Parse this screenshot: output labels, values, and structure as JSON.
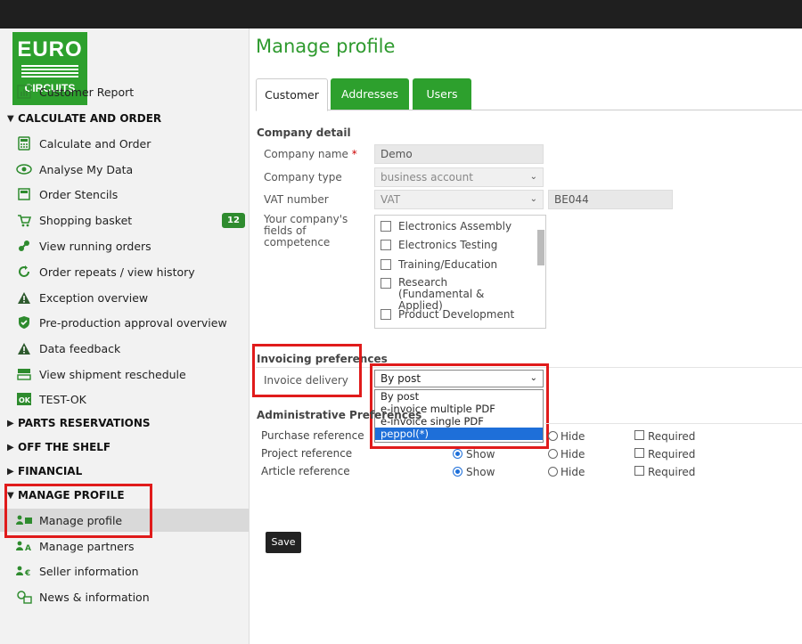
{
  "logo": {
    "line1": "EURO",
    "line2": "CIRCUITS"
  },
  "sidebar": {
    "items": [
      {
        "label": "Customer Report",
        "icon": "report-icon"
      },
      {
        "label": "CALCULATE AND ORDER",
        "section": true,
        "expanded": true
      },
      {
        "label": "Calculate and Order",
        "icon": "calculator-icon"
      },
      {
        "label": "Analyse My Data",
        "icon": "eye-icon"
      },
      {
        "label": "Order Stencils",
        "icon": "stencil-icon"
      },
      {
        "label": "Shopping basket",
        "icon": "cart-icon",
        "badge": "12"
      },
      {
        "label": "View running orders",
        "icon": "running-orders-icon"
      },
      {
        "label": "Order repeats / view history",
        "icon": "repeat-icon"
      },
      {
        "label": "Exception overview",
        "icon": "warning-icon"
      },
      {
        "label": "Pre-production approval overview",
        "icon": "shield-check-icon"
      },
      {
        "label": "Data feedback",
        "icon": "warning-icon"
      },
      {
        "label": "View shipment reschedule",
        "icon": "shipment-icon"
      },
      {
        "label": "TEST-OK",
        "icon": "ok-icon"
      },
      {
        "label": "PARTS RESERVATIONS",
        "section": true,
        "expanded": false
      },
      {
        "label": "OFF THE SHELF",
        "section": true,
        "expanded": false
      },
      {
        "label": "FINANCIAL",
        "section": true,
        "expanded": false
      },
      {
        "label": "MANAGE PROFILE",
        "section": true,
        "expanded": true
      },
      {
        "label": "Manage profile",
        "icon": "profile-card-icon",
        "active": true
      },
      {
        "label": "Manage partners",
        "icon": "partners-icon"
      },
      {
        "label": "Seller information",
        "icon": "seller-icon"
      },
      {
        "label": "News & information",
        "icon": "news-icon"
      }
    ]
  },
  "main": {
    "title": "Manage profile",
    "tabs": [
      {
        "label": "Customer",
        "active": true
      },
      {
        "label": "Addresses"
      },
      {
        "label": "Users"
      }
    ],
    "company_detail": {
      "heading": "Company detail",
      "company_name_label": "Company name",
      "company_name_required": "*",
      "company_name_value": "Demo",
      "company_type_label": "Company type",
      "company_type_value": "business account",
      "vat_label": "VAT number",
      "vat_select_value": "VAT",
      "vat_value": "BE044",
      "fields_label": "Your company's fields of competence",
      "fields_options": [
        "Electronics Assembly",
        "Electronics Testing",
        "Training/Education",
        "Research (Fundamental & Applied)",
        "Product Development"
      ]
    },
    "invoicing": {
      "heading": "Invoicing preferences",
      "delivery_label": "Invoice delivery",
      "delivery_value": "By post",
      "options": [
        "By post",
        "e-invoice multiple PDF",
        "e-invoice single PDF",
        "peppol(*)"
      ],
      "highlighted_option": "peppol(*)"
    },
    "admin": {
      "heading": "Administrative Preferences",
      "rows": [
        {
          "label": "Purchase reference",
          "show": "Show",
          "hide": "Hide",
          "required": "Required"
        },
        {
          "label": "Project reference",
          "show": "Show",
          "hide": "Hide",
          "required": "Required"
        },
        {
          "label": "Article reference",
          "show": "Show",
          "hide": "Hide",
          "required": "Required"
        }
      ]
    },
    "save_label": "Save"
  },
  "colors": {
    "brand_green": "#2da02d",
    "highlight_red": "#e01b1b",
    "select_blue": "#1e6fd9"
  }
}
